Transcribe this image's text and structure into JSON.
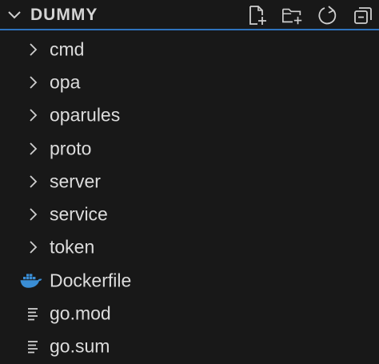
{
  "explorer": {
    "title": "DUMMY",
    "actions": [
      {
        "name": "new-file",
        "icon": "new-file-icon"
      },
      {
        "name": "new-folder",
        "icon": "new-folder-icon"
      },
      {
        "name": "refresh",
        "icon": "refresh-icon"
      },
      {
        "name": "collapse-all",
        "icon": "collapse-all-icon"
      }
    ]
  },
  "tree": {
    "items": [
      {
        "label": "cmd",
        "type": "folder",
        "icon": "chevron-right-icon"
      },
      {
        "label": "opa",
        "type": "folder",
        "icon": "chevron-right-icon"
      },
      {
        "label": "oparules",
        "type": "folder",
        "icon": "chevron-right-icon"
      },
      {
        "label": "proto",
        "type": "folder",
        "icon": "chevron-right-icon"
      },
      {
        "label": "server",
        "type": "folder",
        "icon": "chevron-right-icon"
      },
      {
        "label": "service",
        "type": "folder",
        "icon": "chevron-right-icon"
      },
      {
        "label": "token",
        "type": "folder",
        "icon": "chevron-right-icon"
      },
      {
        "label": "Dockerfile",
        "type": "file",
        "icon": "docker-icon"
      },
      {
        "label": "go.mod",
        "type": "file",
        "icon": "text-file-icon"
      },
      {
        "label": "go.sum",
        "type": "file",
        "icon": "text-file-icon"
      }
    ]
  },
  "colors": {
    "background": "#181818",
    "text": "#dcdcdc",
    "header_border": "#2f73bd",
    "docker": "#3a8ed6"
  }
}
